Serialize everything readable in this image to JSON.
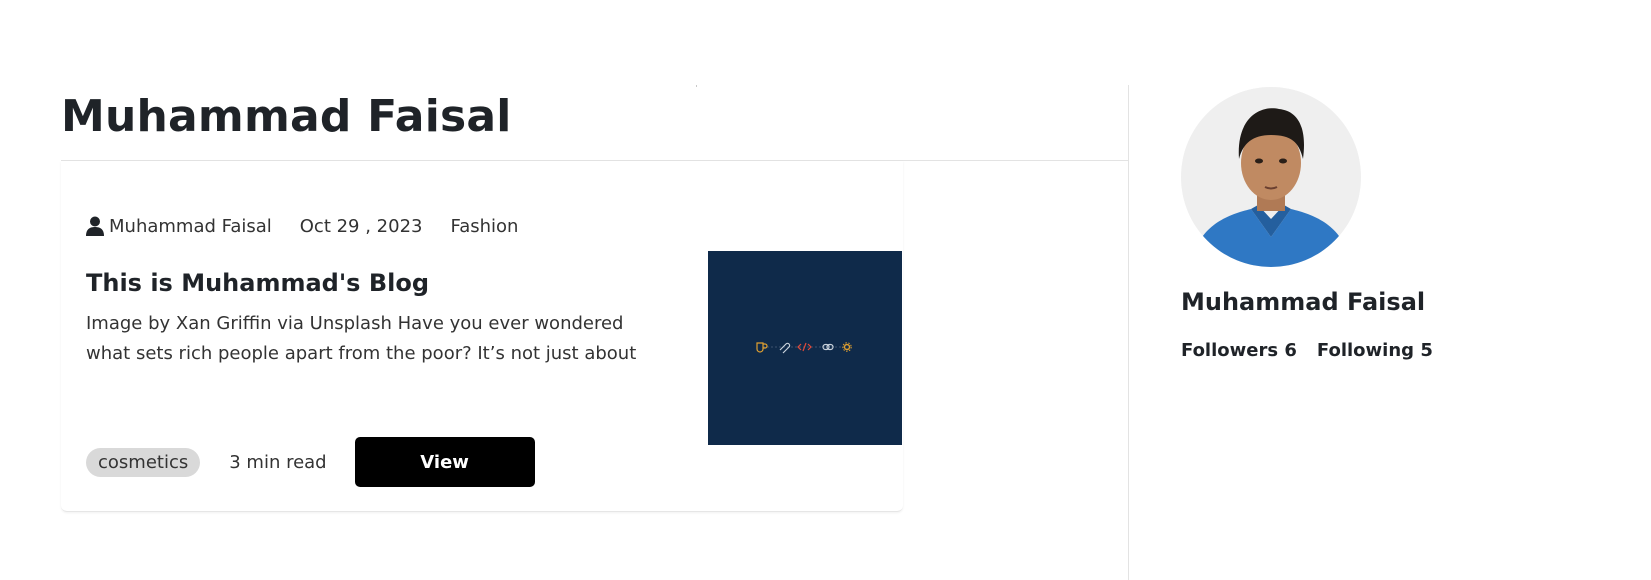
{
  "author_page": {
    "title": "Muhammad Faisal"
  },
  "post": {
    "author": "Muhammad Faisal",
    "date": "Oct 29 , 2023",
    "category": "Fashion",
    "title": "This is Muhammad's Blog",
    "excerpt": "Image by Xan Griffin via Unsplash Have you ever wondered what sets rich people apart from the poor? It’s not just about",
    "tag": "cosmetics",
    "read_time": "3 min read",
    "view_label": "View",
    "thumbnail_bg": "#0f2a4a"
  },
  "profile": {
    "name": "Muhammad Faisal",
    "followers_label": "Followers",
    "followers": "6",
    "following_label": "Following",
    "following": "5"
  },
  "colors": {
    "button": "#000000",
    "tag_bg": "#d9d9d9",
    "text": "#1f2328"
  }
}
